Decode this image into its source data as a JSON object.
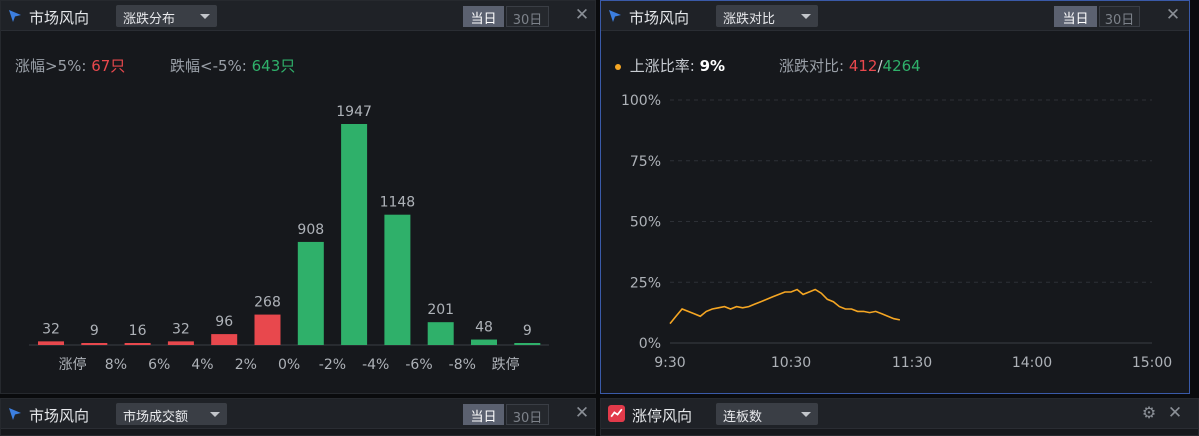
{
  "panels": {
    "tl": {
      "title": "市场风向",
      "select": "涨跌分布",
      "seg_on": "当日",
      "seg_off": "30日",
      "close": "✕",
      "stat1_label": "涨幅>5%:",
      "stat1_value": "67只",
      "stat2_label": "跌幅<-5%:",
      "stat2_value": "643只"
    },
    "tr": {
      "title": "市场风向",
      "select": "涨跌对比",
      "seg_on": "当日",
      "seg_off": "30日",
      "close": "✕",
      "ratio_label": "上涨比率:",
      "ratio_value": "9%",
      "cmp_label": "涨跌对比:",
      "cmp_up": "412",
      "cmp_sep": "/",
      "cmp_down": "4264"
    },
    "bl": {
      "title": "市场风向",
      "select": "市场成交额",
      "seg_on": "当日",
      "seg_off": "30日",
      "close": "✕"
    },
    "br": {
      "title": "涨停风向",
      "select": "连板数",
      "close": "✕",
      "settings_icon": "gear-icon"
    }
  },
  "colors": {
    "up": "#e8484d",
    "down": "#2fb06a",
    "line": "#f5a623",
    "accent_border": "#3a5aa8"
  },
  "chart_data": [
    {
      "type": "bar",
      "categories": [
        "涨停",
        "8%",
        "6%",
        "4%",
        "2%",
        "0%",
        "-2%",
        "-4%",
        "-6%",
        "-8%",
        "跌停"
      ],
      "values": [
        32,
        9,
        16,
        32,
        96,
        268,
        908,
        1947,
        1148,
        201,
        48,
        9
      ],
      "series_colors": [
        "up",
        "up",
        "up",
        "up",
        "up",
        "up",
        "down",
        "down",
        "down",
        "down",
        "down",
        "down"
      ],
      "ylim": [
        0,
        1947
      ]
    },
    {
      "type": "line",
      "x_ticks": [
        "9:30",
        "10:30",
        "11:30",
        "14:00",
        "15:00"
      ],
      "y_ticks": [
        "0%",
        "25%",
        "50%",
        "75%",
        "100%"
      ],
      "ylim": [
        0,
        100
      ],
      "grid": true,
      "x": [
        "9:30",
        "9:33",
        "9:36",
        "9:39",
        "9:42",
        "9:45",
        "9:48",
        "9:51",
        "9:54",
        "9:57",
        "10:00",
        "10:03",
        "10:06",
        "10:09",
        "10:12",
        "10:15",
        "10:18",
        "10:21",
        "10:24",
        "10:27",
        "10:30",
        "10:33",
        "10:36",
        "10:39",
        "10:42",
        "10:45",
        "10:48",
        "10:51",
        "10:54",
        "10:57",
        "11:00",
        "11:03",
        "11:06",
        "11:09",
        "11:12",
        "11:15",
        "11:18",
        "11:21",
        "11:24"
      ],
      "values": [
        8,
        11,
        14,
        13,
        12,
        11,
        13,
        14,
        14.5,
        15,
        14,
        15,
        14.5,
        15,
        16,
        17,
        18,
        19,
        20,
        21,
        21,
        22,
        20,
        21,
        22,
        20.5,
        18,
        17,
        15,
        14,
        14,
        13,
        13,
        12.5,
        13,
        12,
        11,
        10,
        9.5
      ]
    }
  ]
}
